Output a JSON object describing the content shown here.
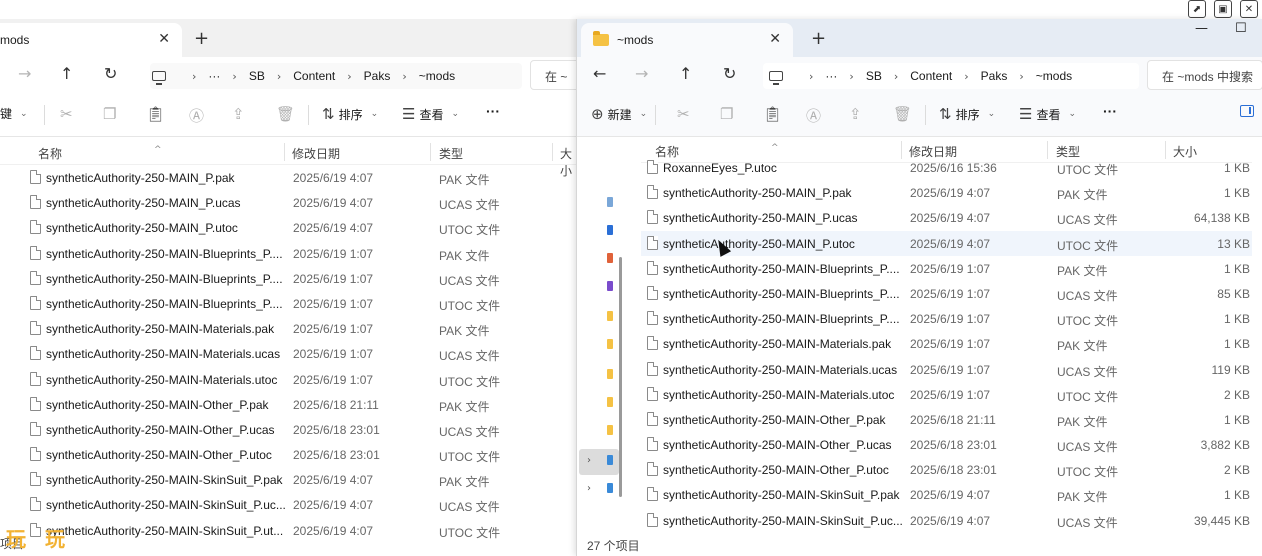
{
  "outer_controls": {
    "popout": "⬈",
    "restore": "▣",
    "close": "✕"
  },
  "left": {
    "tab_title": "mods",
    "tab_close": "✕",
    "tab_new": "+",
    "nav": {
      "forward": "→",
      "up": "↑",
      "refresh": "↻"
    },
    "breadcrumbs": [
      "···",
      "SB",
      "Content",
      "Paks",
      "~mods"
    ],
    "search_placeholder": "在 ~",
    "toolbar": {
      "new_partial": "键",
      "sort": "排序",
      "view": "查看",
      "more": "···"
    },
    "headers": {
      "name": "名称",
      "date": "修改日期",
      "type": "类型",
      "size": "大小"
    },
    "files": [
      {
        "name": "syntheticAuthority-250-MAIN_P.pak",
        "date": "2025/6/19 4:07",
        "type": "PAK 文件"
      },
      {
        "name": "syntheticAuthority-250-MAIN_P.ucas",
        "date": "2025/6/19 4:07",
        "type": "UCAS 文件"
      },
      {
        "name": "syntheticAuthority-250-MAIN_P.utoc",
        "date": "2025/6/19 4:07",
        "type": "UTOC 文件"
      },
      {
        "name": "syntheticAuthority-250-MAIN-Blueprints_P....",
        "date": "2025/6/19 1:07",
        "type": "PAK 文件"
      },
      {
        "name": "syntheticAuthority-250-MAIN-Blueprints_P....",
        "date": "2025/6/19 1:07",
        "type": "UCAS 文件"
      },
      {
        "name": "syntheticAuthority-250-MAIN-Blueprints_P....",
        "date": "2025/6/19 1:07",
        "type": "UTOC 文件"
      },
      {
        "name": "syntheticAuthority-250-MAIN-Materials.pak",
        "date": "2025/6/19 1:07",
        "type": "PAK 文件"
      },
      {
        "name": "syntheticAuthority-250-MAIN-Materials.ucas",
        "date": "2025/6/19 1:07",
        "type": "UCAS 文件"
      },
      {
        "name": "syntheticAuthority-250-MAIN-Materials.utoc",
        "date": "2025/6/19 1:07",
        "type": "UTOC 文件"
      },
      {
        "name": "syntheticAuthority-250-MAIN-Other_P.pak",
        "date": "2025/6/18 21:11",
        "type": "PAK 文件"
      },
      {
        "name": "syntheticAuthority-250-MAIN-Other_P.ucas",
        "date": "2025/6/18 23:01",
        "type": "UCAS 文件"
      },
      {
        "name": "syntheticAuthority-250-MAIN-Other_P.utoc",
        "date": "2025/6/18 23:01",
        "type": "UTOC 文件"
      },
      {
        "name": "syntheticAuthority-250-MAIN-SkinSuit_P.pak",
        "date": "2025/6/19 4:07",
        "type": "PAK 文件"
      },
      {
        "name": "syntheticAuthority-250-MAIN-SkinSuit_P.uc...",
        "date": "2025/6/19 4:07",
        "type": "UCAS 文件"
      },
      {
        "name": "syntheticAuthority-250-MAIN-SkinSuit_P.ut...",
        "date": "2025/6/19 4:07",
        "type": "UTOC 文件"
      }
    ],
    "status_partial": "项目"
  },
  "right": {
    "tab_title": "~mods",
    "tab_close": "✕",
    "tab_new": "+",
    "window_controls": {
      "minimize": "—",
      "maximize": "☐"
    },
    "nav": {
      "back": "←",
      "forward": "→",
      "up": "↑",
      "refresh": "↻"
    },
    "breadcrumbs": [
      "···",
      "SB",
      "Content",
      "Paks",
      "~mods"
    ],
    "search_placeholder": "在 ~mods 中搜索",
    "toolbar": {
      "new": "新建",
      "sort": "排序",
      "view": "查看",
      "more": "···"
    },
    "headers": {
      "name": "名称",
      "date": "修改日期",
      "type": "类型",
      "size": "大小"
    },
    "files": [
      {
        "name": "RoxanneEyes_P.utoc",
        "date": "2025/6/16 15:36",
        "type": "UTOC 文件",
        "size": "1 KB"
      },
      {
        "name": "syntheticAuthority-250-MAIN_P.pak",
        "date": "2025/6/19 4:07",
        "type": "PAK 文件",
        "size": "1 KB"
      },
      {
        "name": "syntheticAuthority-250-MAIN_P.ucas",
        "date": "2025/6/19 4:07",
        "type": "UCAS 文件",
        "size": "64,138 KB"
      },
      {
        "name": "syntheticAuthority-250-MAIN_P.utoc",
        "date": "2025/6/19 4:07",
        "type": "UTOC 文件",
        "size": "13 KB"
      },
      {
        "name": "syntheticAuthority-250-MAIN-Blueprints_P....",
        "date": "2025/6/19 1:07",
        "type": "PAK 文件",
        "size": "1 KB"
      },
      {
        "name": "syntheticAuthority-250-MAIN-Blueprints_P....",
        "date": "2025/6/19 1:07",
        "type": "UCAS 文件",
        "size": "85 KB"
      },
      {
        "name": "syntheticAuthority-250-MAIN-Blueprints_P....",
        "date": "2025/6/19 1:07",
        "type": "UTOC 文件",
        "size": "1 KB"
      },
      {
        "name": "syntheticAuthority-250-MAIN-Materials.pak",
        "date": "2025/6/19 1:07",
        "type": "PAK 文件",
        "size": "1 KB"
      },
      {
        "name": "syntheticAuthority-250-MAIN-Materials.ucas",
        "date": "2025/6/19 1:07",
        "type": "UCAS 文件",
        "size": "119 KB"
      },
      {
        "name": "syntheticAuthority-250-MAIN-Materials.utoc",
        "date": "2025/6/19 1:07",
        "type": "UTOC 文件",
        "size": "2 KB"
      },
      {
        "name": "syntheticAuthority-250-MAIN-Other_P.pak",
        "date": "2025/6/18 21:11",
        "type": "PAK 文件",
        "size": "1 KB"
      },
      {
        "name": "syntheticAuthority-250-MAIN-Other_P.ucas",
        "date": "2025/6/18 23:01",
        "type": "UCAS 文件",
        "size": "3,882 KB"
      },
      {
        "name": "syntheticAuthority-250-MAIN-Other_P.utoc",
        "date": "2025/6/18 23:01",
        "type": "UTOC 文件",
        "size": "2 KB"
      },
      {
        "name": "syntheticAuthority-250-MAIN-SkinSuit_P.pak",
        "date": "2025/6/19 4:07",
        "type": "PAK 文件",
        "size": "1 KB"
      },
      {
        "name": "syntheticAuthority-250-MAIN-SkinSuit_P.uc...",
        "date": "2025/6/19 4:07",
        "type": "UCAS 文件",
        "size": "39,445 KB"
      }
    ],
    "status": "27 个项目"
  },
  "watermark": "玩 玩",
  "colors": {
    "folder": "#f5c244",
    "accent": "#2b6fd6",
    "selected_row": "#f0f5fc"
  }
}
